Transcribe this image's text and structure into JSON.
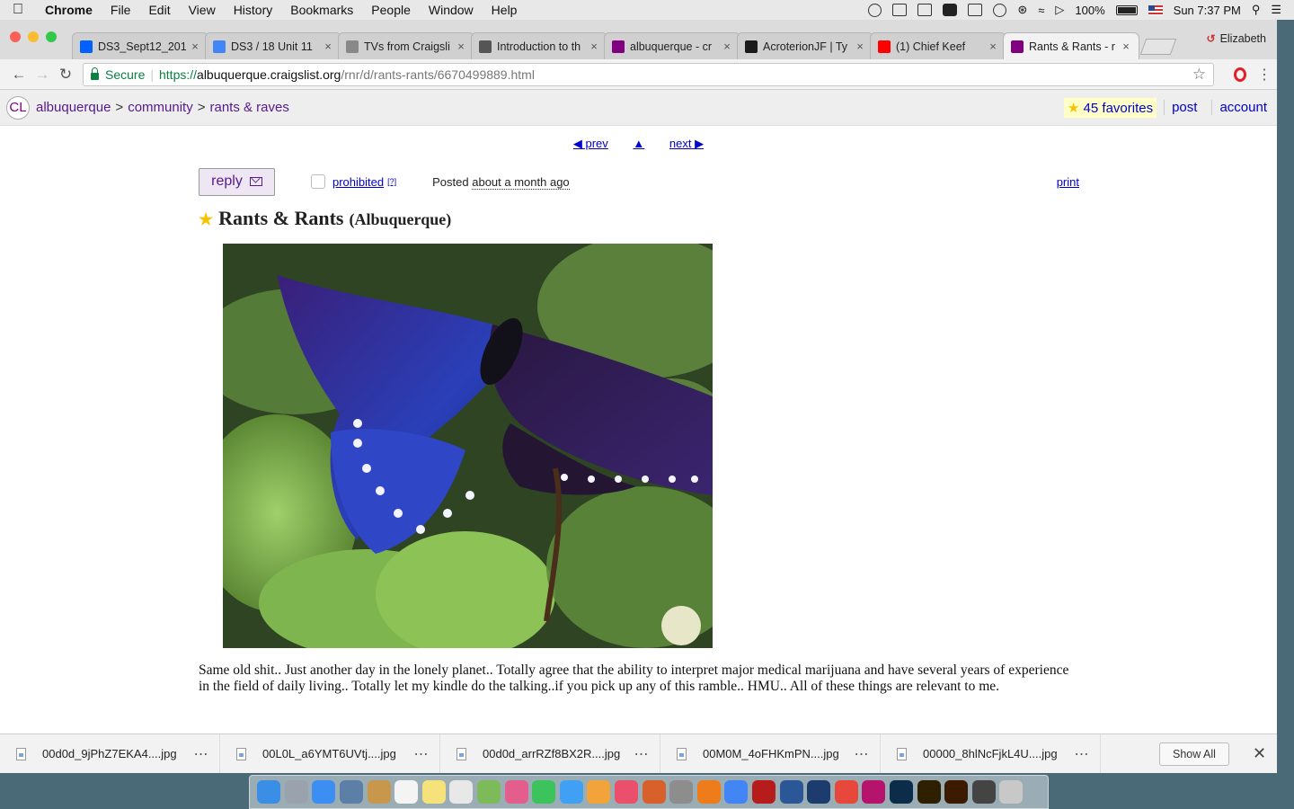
{
  "menubar": {
    "app": "Chrome",
    "items": [
      "File",
      "Edit",
      "View",
      "History",
      "Bookmarks",
      "People",
      "Window",
      "Help"
    ],
    "battery": "100%",
    "clock": "Sun 7:37 PM"
  },
  "tabs": [
    {
      "title": "DS3_Sept12_201",
      "fav_color": "#0061fe",
      "active": false
    },
    {
      "title": "DS3 / 18 Unit 11",
      "fav_color": "#4285f4",
      "active": false
    },
    {
      "title": "TVs from Craigsli",
      "fav_color": "#888888",
      "active": false
    },
    {
      "title": "Introduction to th",
      "fav_color": "#555555",
      "active": false
    },
    {
      "title": "albuquerque - cr",
      "fav_color": "#800080",
      "active": false
    },
    {
      "title": "AcroterionJF | Ty",
      "fav_color": "#1a1a1a",
      "active": false
    },
    {
      "title": "(1) Chief Keef",
      "fav_color": "#ff0000",
      "active": false
    },
    {
      "title": "Rants & Rants - r",
      "fav_color": "#800080",
      "active": true
    }
  ],
  "profile_name": "Elizabeth",
  "address_bar": {
    "secure_label": "Secure",
    "scheme": "https://",
    "host": "albuquerque.craigslist.org",
    "path": "/rnr/d/rants-rants/6670499889.html"
  },
  "header": {
    "logo": "CL",
    "crumbs": [
      "albuquerque",
      "community",
      "rants & raves"
    ],
    "favorites": "45 favorites",
    "post": "post",
    "account": "account"
  },
  "postnav": {
    "prev": "◀ prev",
    "up": "▲",
    "next": "next ▶"
  },
  "actions": {
    "reply": "reply",
    "prohibited": "prohibited",
    "help": "[?]",
    "posted_prefix": "Posted",
    "posted_ago": "about a month ago",
    "print": "print"
  },
  "posting": {
    "title": "Rants & Rants",
    "location": "(Albuquerque)",
    "body": "Same old shit.. Just another day in the lonely planet.. Totally agree that the ability to interpret major medical marijuana and have several years of experience in the field of daily living.. Totally let my kindle do the talking..if you pick up any of this ramble.. HMU.. All of these things are relevant to me."
  },
  "downloads": {
    "items": [
      "00d0d_9jPhZ7EKA4....jpg",
      "00L0L_a6YMT6UVtj....jpg",
      "00d0d_arrRZf8BX2R....jpg",
      "00M0M_4oFHKmPN....jpg",
      "00000_8hlNcFjkL4U....jpg"
    ],
    "show_all": "Show All"
  },
  "dock_colors": [
    "#3a8ee6",
    "#9aa3ad",
    "#3d8ef2",
    "#5c7fa8",
    "#c8974c",
    "#f4f4f4",
    "#f6e27a",
    "#e8e8e8",
    "#7dbb5a",
    "#e35d8d",
    "#3cc35b",
    "#3fa0f4",
    "#f2a33a",
    "#ea4f6b",
    "#d8612b",
    "#8d8d8d",
    "#ef7c1a",
    "#4285f4",
    "#b71c1c",
    "#2b5797",
    "#1d3c6e",
    "#e8473c",
    "#b5136c",
    "#0b2d4a",
    "#2e1f00",
    "#3c1a00",
    "#444444",
    "#c8c8c8"
  ]
}
